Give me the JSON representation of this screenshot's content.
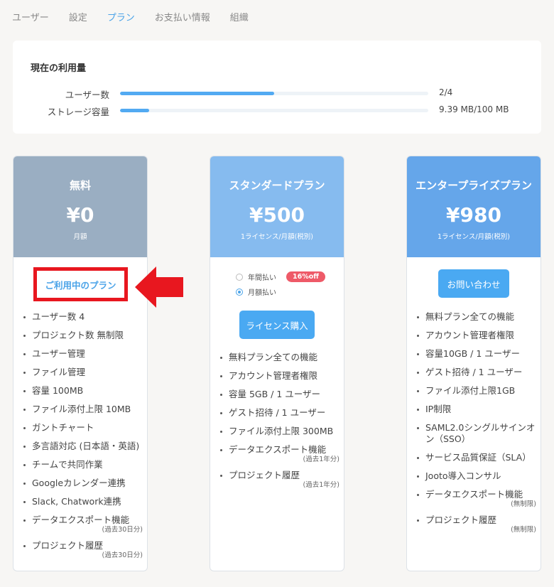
{
  "tabs": [
    {
      "label": "ユーザー",
      "active": false
    },
    {
      "label": "設定",
      "active": false
    },
    {
      "label": "プラン",
      "active": true
    },
    {
      "label": "お支払い情報",
      "active": false
    },
    {
      "label": "組織",
      "active": false
    }
  ],
  "usage": {
    "title": "現在の利用量",
    "rows": [
      {
        "label": "ユーザー数",
        "value": "2/4",
        "progress": 0.5
      },
      {
        "label": "ストレージ容量",
        "value": "9.39 MB/100 MB",
        "progress": 0.094
      }
    ]
  },
  "plans": {
    "free": {
      "name": "無料",
      "price": "¥0",
      "note": "月額",
      "header_color": "#9aaec2",
      "current_label": "ご利用中のプラン",
      "features": [
        {
          "text": "ユーザー数 4"
        },
        {
          "text": "プロジェクト数 無制限"
        },
        {
          "text": "ユーザー管理"
        },
        {
          "text": "ファイル管理"
        },
        {
          "text": "容量 100MB"
        },
        {
          "text": "ファイル添付上限 10MB"
        },
        {
          "text": "ガントチャート"
        },
        {
          "text": "多言語対応 (日本語・英語)"
        },
        {
          "text": "チームで共同作業"
        },
        {
          "text": "Googleカレンダー連携"
        },
        {
          "text": "Slack, Chatwork連携"
        },
        {
          "text": "データエクスポート機能",
          "sub": "(過去30日分)"
        },
        {
          "text": "プロジェクト履歴",
          "sub": "(過去30日分)"
        }
      ]
    },
    "standard": {
      "name": "スタンダードプラン",
      "price": "¥500",
      "note": "1ライセンス/月額(税別)",
      "header_color": "#86bbef",
      "billing": {
        "yearly_label": "年間払い",
        "monthly_label": "月額払い",
        "selected": "monthly",
        "discount_badge": "16%off"
      },
      "button_label": "ライセンス購入",
      "features": [
        {
          "text": "無料プラン全ての機能"
        },
        {
          "text": "アカウント管理者権限"
        },
        {
          "text": "容量 5GB / 1 ユーザー"
        },
        {
          "text": "ゲスト招待 / 1 ユーザー"
        },
        {
          "text": "ファイル添付上限 300MB"
        },
        {
          "text": "データエクスポート機能",
          "sub": "(過去1年分)"
        },
        {
          "text": "プロジェクト履歴",
          "sub": "(過去1年分)"
        }
      ]
    },
    "enterprise": {
      "name": "エンタープライズプラン",
      "price": "¥980",
      "note": "1ライセンス/月額(税別)",
      "header_color": "#65a6ea",
      "button_label": "お問い合わせ",
      "features": [
        {
          "text": "無料プラン全ての機能"
        },
        {
          "text": "アカウント管理者権限"
        },
        {
          "text": "容量10GB / 1 ユーザー"
        },
        {
          "text": "ゲスト招待 / 1 ユーザー"
        },
        {
          "text": "ファイル添付上限1GB"
        },
        {
          "text": "IP制限"
        },
        {
          "text": "SAML2.0シングルサインオン（SSO）"
        },
        {
          "text": "サービス品質保証（SLA）"
        },
        {
          "text": "Jooto導入コンサル"
        },
        {
          "text": "データエクスポート機能",
          "sub": "(無制限)"
        },
        {
          "text": "プロジェクト履歴",
          "sub": "(無制限)"
        }
      ]
    }
  },
  "colors": {
    "accent": "#4aa3e8",
    "highlight_red": "#e8171f",
    "badge": "#ee5a68"
  }
}
